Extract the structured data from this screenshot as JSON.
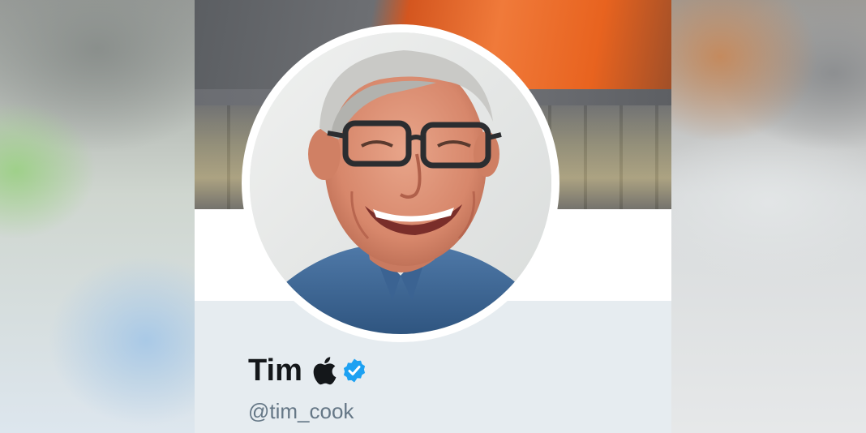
{
  "profile": {
    "display_name": "Tim",
    "handle": "@tim_cook",
    "name_emoji_icon": "apple-logo-icon",
    "verified_icon": "verified-badge-icon",
    "avatar_icon": "profile-photo",
    "banner_icon": "header-photo"
  },
  "colors": {
    "name_text": "#14171a",
    "handle_text": "#657786",
    "verified_blue": "#1da1f2",
    "info_background": "#e6ecf0"
  }
}
